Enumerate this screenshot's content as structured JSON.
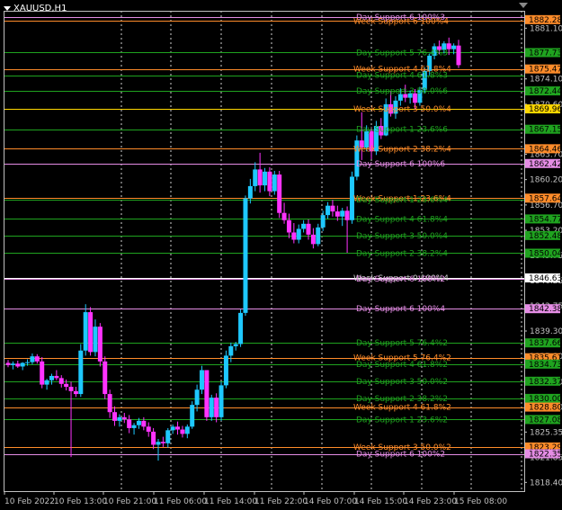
{
  "window": {
    "symbol_timeframe": "XAUUSD,H1"
  },
  "colors": {
    "bg": "#000000",
    "axis": "#c0c0c0",
    "bull": "#1ec8ff",
    "bear": "#ff33ff",
    "week_line": "#ff8c2a",
    "day_line": "#1fa31f",
    "level100": "#e58de5",
    "yellow": "#ffd700"
  },
  "chart_data": {
    "type": "candlestick",
    "ylim": [
      1817.2,
      1883.5
    ],
    "y_ticks": [
      1881.1,
      1874.1,
      1870.6,
      1863.7,
      1860.2,
      1856.7,
      1853.2,
      1849.75,
      1846.25,
      1842.75,
      1839.3,
      1835.8,
      1832.3,
      1828.8,
      1825.35,
      1821.85,
      1818.4
    ],
    "x_labels": [
      "10 Feb 2022",
      "10 Feb 13:00",
      "10 Feb 21:00",
      "11 Feb 06:00",
      "11 Feb 14:00",
      "11 Feb 22:00",
      "14 Feb 07:00",
      "14 Feb 15:00",
      "14 Feb 23:00",
      "15 Feb 08:00"
    ],
    "price_tags": [
      {
        "price": "1882.28",
        "bg": "#ff8c2a",
        "fg": "#000000"
      },
      {
        "price": "1877.73",
        "bg": "#1fa31f",
        "fg": "#000000"
      },
      {
        "price": "1875.47",
        "bg": "#ff8c2a",
        "fg": "#000000"
      },
      {
        "price": "1872.44",
        "bg": "#1fa31f",
        "fg": "#000000"
      },
      {
        "price": "1869.96",
        "bg": "#ffd700",
        "fg": "#000000"
      },
      {
        "price": "1867.15",
        "bg": "#1fa31f",
        "fg": "#000000"
      },
      {
        "price": "1864.46",
        "bg": "#ff8c2a",
        "fg": "#000000"
      },
      {
        "price": "1862.42",
        "bg": "#e58de5",
        "fg": "#000000"
      },
      {
        "price": "1857.64",
        "bg": "#ff8c2a",
        "fg": "#000000"
      },
      {
        "price": "1854.77",
        "bg": "#1fa31f",
        "fg": "#000000"
      },
      {
        "price": "1852.48",
        "bg": "#1fa31f",
        "fg": "#000000"
      },
      {
        "price": "1850.04",
        "bg": "#1fa31f",
        "fg": "#000000"
      },
      {
        "price": "1846.63",
        "bg": "#ffffff",
        "fg": "#000000"
      },
      {
        "price": "1842.38",
        "bg": "#e58de5",
        "fg": "#000000"
      },
      {
        "price": "1837.66",
        "bg": "#1fa31f",
        "fg": "#000000"
      },
      {
        "price": "1835.61",
        "bg": "#ff8c2a",
        "fg": "#000000"
      },
      {
        "price": "1834.73",
        "bg": "#1fa31f",
        "fg": "#000000"
      },
      {
        "price": "1832.37",
        "bg": "#1fa31f",
        "fg": "#000000"
      },
      {
        "price": "1830.00",
        "bg": "#1fa31f",
        "fg": "#000000"
      },
      {
        "price": "1828.80",
        "bg": "#ff8c2a",
        "fg": "#000000"
      },
      {
        "price": "1827.08",
        "bg": "#1fa31f",
        "fg": "#000000"
      },
      {
        "price": "1823.29",
        "bg": "#ff8c2a",
        "fg": "#000000"
      },
      {
        "price": "1822.35",
        "bg": "#e58de5",
        "fg": "#000000"
      }
    ],
    "levels": [
      {
        "price": 1882.6,
        "label": "Day Support 6 100%3",
        "kind": "day100"
      },
      {
        "price": 1882.1,
        "label": "Week Support 6 100%4",
        "kind": "week"
      },
      {
        "price": 1877.73,
        "label": "Day Support 5 76.4%3",
        "kind": "day"
      },
      {
        "price": 1875.47,
        "label": "Week Support 4 61.8%4",
        "kind": "week"
      },
      {
        "price": 1874.6,
        "label": "Day Support 4 61.8%3",
        "kind": "day"
      },
      {
        "price": 1872.44,
        "label": "Day Support 3 50.0%6",
        "kind": "day"
      },
      {
        "price": 1869.96,
        "label": "Week Support 3 50.0%4",
        "kind": "yellow"
      },
      {
        "price": 1867.15,
        "label": "Day Support 1 23.6%6",
        "kind": "day"
      },
      {
        "price": 1864.46,
        "label": "Week Support 2 38.2%4",
        "kind": "week"
      },
      {
        "price": 1862.42,
        "label": "Day Support 6 100%6",
        "kind": "day100"
      },
      {
        "price": 1857.64,
        "label": "Week Support 1 23.6%4",
        "kind": "week"
      },
      {
        "price": 1857.4,
        "label": "Day Support 1 23.6%4",
        "kind": "day"
      },
      {
        "price": 1854.77,
        "label": "Day Support 4 61.8%4",
        "kind": "day"
      },
      {
        "price": 1852.48,
        "label": "Day Support 3 50.0%4",
        "kind": "day"
      },
      {
        "price": 1850.04,
        "label": "Day Support 2 38.2%4",
        "kind": "day"
      },
      {
        "price": 1846.63,
        "label": "Week Support 0 100%4",
        "kind": "white"
      },
      {
        "price": 1846.5,
        "label": "Day Support 6 100%2",
        "kind": "day100"
      },
      {
        "price": 1842.38,
        "label": "Day Support 6 100%4",
        "kind": "day100"
      },
      {
        "price": 1837.66,
        "label": "Day Support 5 76.4%2",
        "kind": "day"
      },
      {
        "price": 1835.61,
        "label": "Week Support 5 76.4%2",
        "kind": "week"
      },
      {
        "price": 1834.73,
        "label": "Day Support 4 61.8%2",
        "kind": "day"
      },
      {
        "price": 1832.37,
        "label": "Day Support 3 50.0%2",
        "kind": "day"
      },
      {
        "price": 1830.0,
        "label": "Day Support 2 38.2%2",
        "kind": "day"
      },
      {
        "price": 1828.8,
        "label": "Week Support 4 61.8%2",
        "kind": "week"
      },
      {
        "price": 1827.08,
        "label": "Day Support 1 23.6%2",
        "kind": "day"
      },
      {
        "price": 1823.29,
        "label": "Week Support 3 50.0%2",
        "kind": "week"
      },
      {
        "price": 1822.35,
        "label": "Day Support 6 100%2",
        "kind": "day100"
      }
    ],
    "candles": [
      [
        1834.9,
        1835.3,
        1834.3,
        1834.6
      ],
      [
        1834.6,
        1835.1,
        1834.0,
        1834.8
      ],
      [
        1834.8,
        1835.2,
        1834.2,
        1834.4
      ],
      [
        1834.4,
        1835.0,
        1833.9,
        1834.9
      ],
      [
        1834.9,
        1835.4,
        1834.5,
        1835.0
      ],
      [
        1835.0,
        1836.2,
        1834.7,
        1835.8
      ],
      [
        1835.8,
        1836.1,
        1834.8,
        1835.1
      ],
      [
        1835.1,
        1835.7,
        1831.4,
        1831.9
      ],
      [
        1831.9,
        1832.7,
        1831.2,
        1832.5
      ],
      [
        1832.5,
        1833.4,
        1831.9,
        1833.1
      ],
      [
        1833.1,
        1833.9,
        1832.5,
        1832.8
      ],
      [
        1832.8,
        1833.2,
        1831.5,
        1832.0
      ],
      [
        1832.0,
        1832.6,
        1831.1,
        1831.6
      ],
      [
        1831.6,
        1832.3,
        1821.9,
        1831.0
      ],
      [
        1831.0,
        1831.6,
        1830.2,
        1830.6
      ],
      [
        1830.6,
        1837.5,
        1830.2,
        1836.6
      ],
      [
        1836.6,
        1843.0,
        1835.9,
        1841.9
      ],
      [
        1841.9,
        1842.6,
        1835.9,
        1836.4
      ],
      [
        1836.4,
        1840.9,
        1835.8,
        1839.9
      ],
      [
        1839.9,
        1840.4,
        1834.4,
        1835.1
      ],
      [
        1835.1,
        1835.8,
        1829.9,
        1830.6
      ],
      [
        1830.6,
        1831.2,
        1827.3,
        1828.1
      ],
      [
        1828.1,
        1828.9,
        1826.2,
        1826.9
      ],
      [
        1826.9,
        1827.8,
        1826.1,
        1827.4
      ],
      [
        1827.4,
        1828.0,
        1826.6,
        1827.1
      ],
      [
        1827.1,
        1827.7,
        1825.2,
        1825.9
      ],
      [
        1825.9,
        1826.6,
        1825.0,
        1826.3
      ],
      [
        1826.3,
        1827.3,
        1825.8,
        1826.9
      ],
      [
        1826.9,
        1827.4,
        1825.6,
        1826.1
      ],
      [
        1826.1,
        1826.7,
        1824.7,
        1825.4
      ],
      [
        1825.4,
        1825.9,
        1823.0,
        1823.6
      ],
      [
        1823.6,
        1824.4,
        1821.4,
        1824.0
      ],
      [
        1824.0,
        1824.7,
        1823.3,
        1823.8
      ],
      [
        1823.8,
        1825.9,
        1823.2,
        1825.6
      ],
      [
        1825.6,
        1826.4,
        1825.1,
        1826.1
      ],
      [
        1826.1,
        1826.8,
        1825.0,
        1825.7
      ],
      [
        1825.7,
        1826.2,
        1824.6,
        1825.1
      ],
      [
        1825.1,
        1826.4,
        1824.5,
        1826.1
      ],
      [
        1826.1,
        1829.6,
        1825.8,
        1829.1
      ],
      [
        1829.1,
        1831.9,
        1828.2,
        1831.2
      ],
      [
        1831.2,
        1834.5,
        1830.6,
        1833.9
      ],
      [
        1833.9,
        1830.6,
        1826.9,
        1827.4
      ],
      [
        1827.4,
        1830.5,
        1826.9,
        1830.1
      ],
      [
        1830.1,
        1830.7,
        1826.7,
        1827.4
      ],
      [
        1827.4,
        1832.3,
        1826.9,
        1831.8
      ],
      [
        1831.8,
        1836.6,
        1831.4,
        1835.9
      ],
      [
        1835.9,
        1837.7,
        1835.0,
        1837.2
      ],
      [
        1837.2,
        1837.8,
        1836.6,
        1837.5
      ],
      [
        1837.5,
        1842.3,
        1837.1,
        1841.8
      ],
      [
        1841.8,
        1858.0,
        1841.4,
        1857.6
      ],
      [
        1857.6,
        1860.3,
        1856.9,
        1859.3
      ],
      [
        1859.3,
        1862.6,
        1858.6,
        1861.6
      ],
      [
        1861.6,
        1863.9,
        1858.4,
        1859.4
      ],
      [
        1859.4,
        1861.8,
        1858.6,
        1861.3
      ],
      [
        1861.3,
        1861.9,
        1857.9,
        1858.6
      ],
      [
        1858.6,
        1861.4,
        1858.1,
        1860.9
      ],
      [
        1860.9,
        1861.4,
        1854.9,
        1855.6
      ],
      [
        1855.6,
        1857.0,
        1854.1,
        1854.6
      ],
      [
        1854.6,
        1855.5,
        1852.1,
        1852.9
      ],
      [
        1852.9,
        1854.2,
        1851.4,
        1851.9
      ],
      [
        1851.9,
        1854.0,
        1851.4,
        1853.4
      ],
      [
        1853.4,
        1854.6,
        1852.9,
        1854.1
      ],
      [
        1854.1,
        1854.7,
        1851.9,
        1852.6
      ],
      [
        1852.6,
        1853.5,
        1850.7,
        1851.3
      ],
      [
        1851.3,
        1854.1,
        1851.0,
        1853.6
      ],
      [
        1853.6,
        1855.9,
        1853.1,
        1855.3
      ],
      [
        1855.3,
        1857.1,
        1854.8,
        1856.6
      ],
      [
        1856.6,
        1857.4,
        1855.1,
        1855.8
      ],
      [
        1855.8,
        1856.6,
        1854.5,
        1855.1
      ],
      [
        1855.1,
        1856.3,
        1853.8,
        1855.9
      ],
      [
        1855.9,
        1856.5,
        1850.1,
        1854.6
      ],
      [
        1854.6,
        1861.3,
        1854.1,
        1860.6
      ],
      [
        1860.6,
        1866.3,
        1860.1,
        1865.6
      ],
      [
        1865.6,
        1869.5,
        1862.9,
        1864.6
      ],
      [
        1864.6,
        1867.7,
        1864.1,
        1866.9
      ],
      [
        1866.9,
        1867.5,
        1863.0,
        1864.1
      ],
      [
        1864.1,
        1868.3,
        1863.6,
        1867.6
      ],
      [
        1867.6,
        1868.7,
        1865.8,
        1866.3
      ],
      [
        1866.3,
        1871.4,
        1866.2,
        1870.6
      ],
      [
        1870.6,
        1872.4,
        1868.9,
        1869.3
      ],
      [
        1869.3,
        1871.7,
        1868.6,
        1871.1
      ],
      [
        1871.1,
        1872.8,
        1870.4,
        1872.0
      ],
      [
        1872.0,
        1873.3,
        1870.9,
        1871.5
      ],
      [
        1871.5,
        1872.5,
        1870.7,
        1872.1
      ],
      [
        1872.1,
        1872.7,
        1869.9,
        1870.8
      ],
      [
        1870.8,
        1873.0,
        1870.4,
        1872.6
      ],
      [
        1872.6,
        1875.7,
        1872.1,
        1875.2
      ],
      [
        1875.2,
        1877.6,
        1874.6,
        1877.3
      ],
      [
        1877.3,
        1879.0,
        1876.8,
        1878.6
      ],
      [
        1878.6,
        1879.4,
        1877.5,
        1878.1
      ],
      [
        1878.1,
        1879.3,
        1877.6,
        1879.0
      ],
      [
        1879.0,
        1879.8,
        1877.4,
        1878.2
      ],
      [
        1878.2,
        1879.0,
        1877.5,
        1878.7
      ],
      [
        1878.7,
        1879.5,
        1875.6,
        1876.0
      ]
    ]
  }
}
